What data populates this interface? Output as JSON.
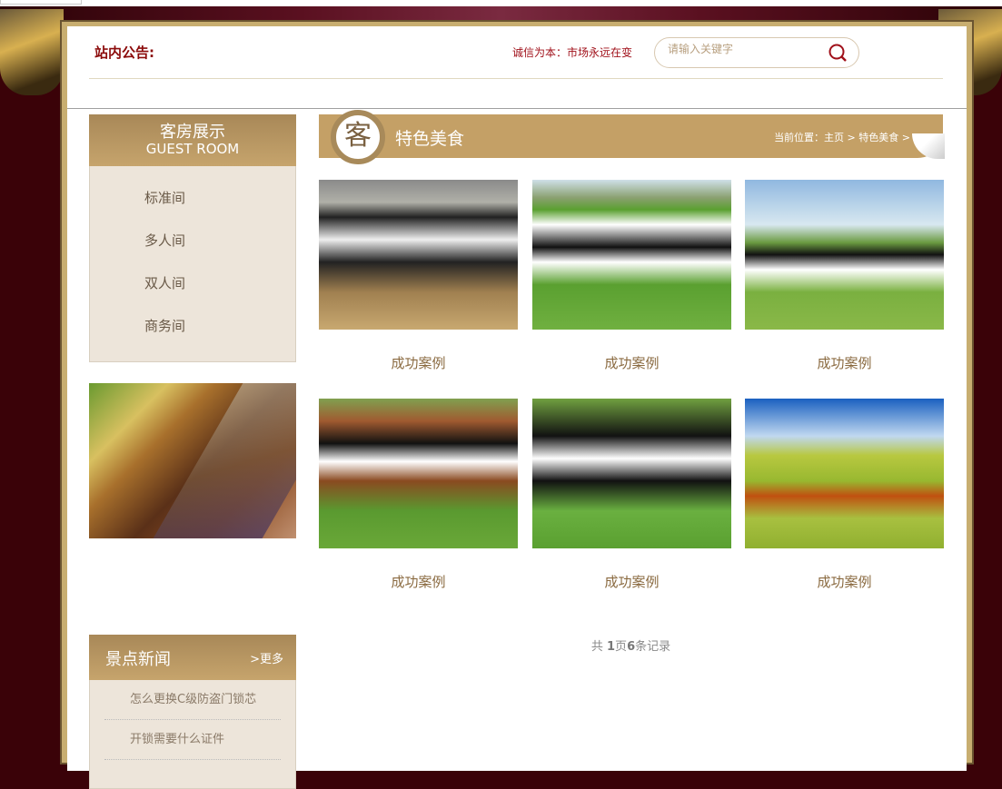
{
  "header": {
    "notice_label": "站内公告:",
    "marquee": "诚信为本：市场永远在变",
    "search_placeholder": "请输入关键字"
  },
  "sidebar": {
    "title": "客房展示",
    "subtitle": "GUEST ROOM",
    "items": [
      {
        "label": "标准间"
      },
      {
        "label": "多人间"
      },
      {
        "label": "双人间"
      },
      {
        "label": "商务间"
      }
    ]
  },
  "news": {
    "title": "景点新闻",
    "more": ">更多",
    "items": [
      {
        "label": "怎么更换C级防盗门锁芯"
      },
      {
        "label": "开锁需要什么证件"
      }
    ]
  },
  "main": {
    "badge": "客",
    "title": "特色美食",
    "breadcrumb": "当前位置：主页 > 特色美食 >",
    "items": [
      {
        "caption": "成功案例"
      },
      {
        "caption": "成功案例"
      },
      {
        "caption": "成功案例"
      },
      {
        "caption": "成功案例"
      },
      {
        "caption": "成功案例"
      },
      {
        "caption": "成功案例"
      }
    ]
  },
  "pager": {
    "pre": "共 ",
    "pages": "1",
    "mid": "页",
    "count": "6",
    "post": "条记录"
  },
  "colors": {
    "accent": "#c4a066",
    "notice": "#8b0a0a",
    "background": "#3a0208"
  }
}
